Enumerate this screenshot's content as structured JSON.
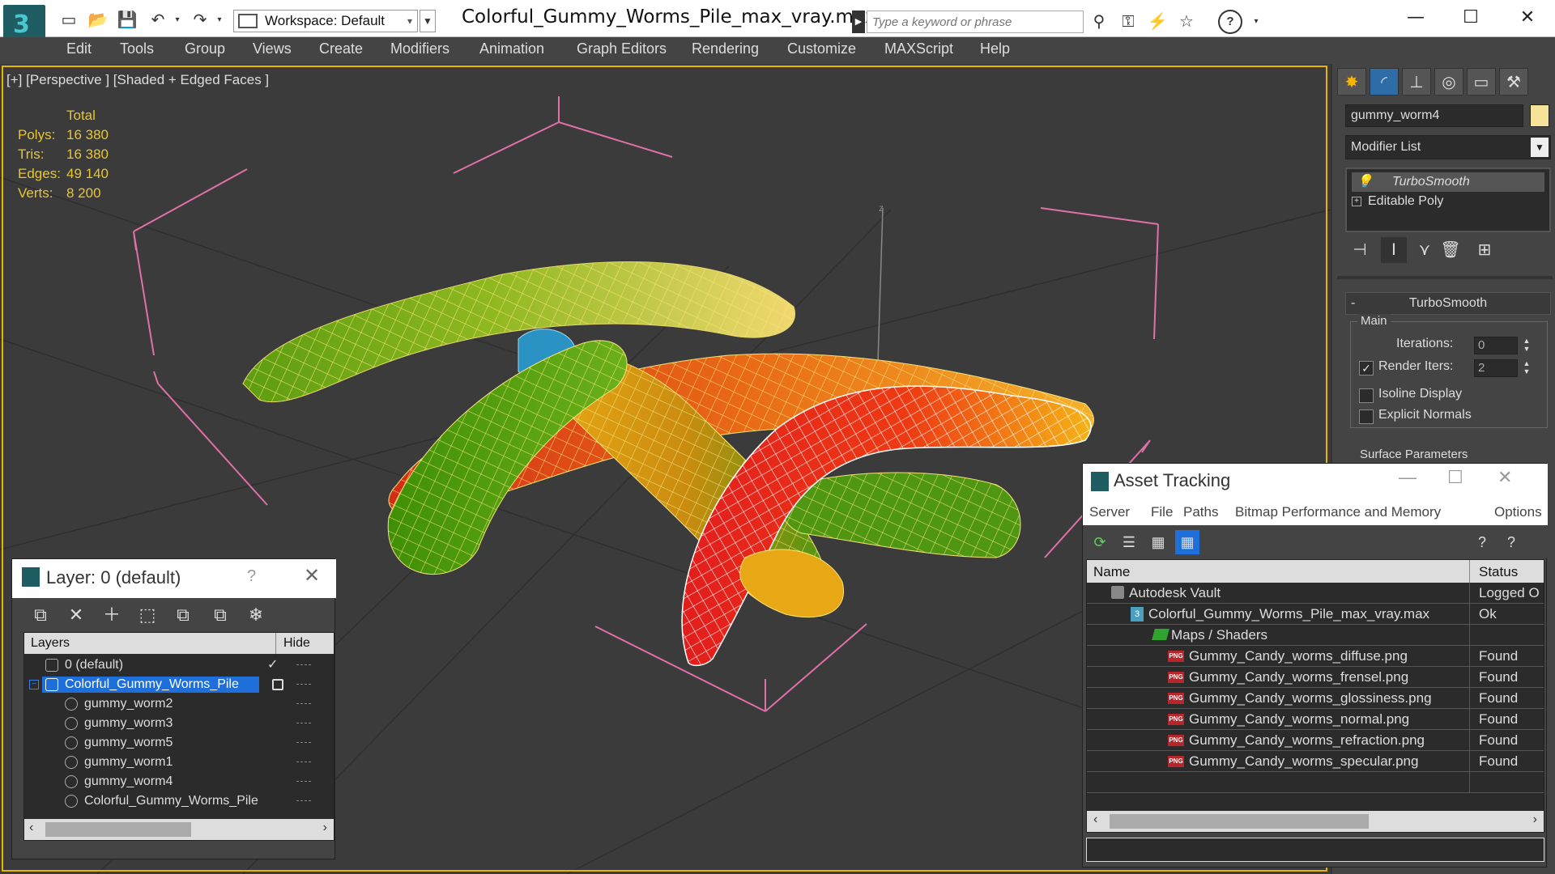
{
  "titlebar": {
    "workspace_label": "Workspace: Default",
    "document_title": "Colorful_Gummy_Worms_Pile_max_vray.max",
    "search_placeholder": "Type a keyword or phrase"
  },
  "menu": [
    "Edit",
    "Tools",
    "Group",
    "Views",
    "Create",
    "Modifiers",
    "Animation",
    "Graph Editors",
    "Rendering",
    "Customize",
    "MAXScript",
    "Help"
  ],
  "viewport": {
    "label": "[+] [Perspective ] [Shaded + Edged Faces ]",
    "stats": {
      "header": "Total",
      "rows": [
        {
          "label": "Polys:",
          "value": "16 380"
        },
        {
          "label": "Tris:",
          "value": "16 380"
        },
        {
          "label": "Edges:",
          "value": "49 140"
        },
        {
          "label": "Verts:",
          "value": "8 200"
        }
      ]
    },
    "axis_label": "z"
  },
  "command_panel": {
    "object_name": "gummy_worm4",
    "modifier_list_label": "Modifier List",
    "stack": [
      "TurboSmooth",
      "Editable Poly"
    ],
    "rollout_title": "TurboSmooth",
    "main_group": "Main",
    "iterations_label": "Iterations:",
    "iterations_value": "0",
    "render_iters_label": "Render Iters:",
    "render_iters_value": "2",
    "render_iters_checked": true,
    "isoline_label": "Isoline Display",
    "explicit_normals_label": "Explicit Normals",
    "surface_params_label": "Surface Parameters"
  },
  "layer_panel": {
    "title": "Layer: 0 (default)",
    "help": "?",
    "col_layers": "Layers",
    "col_hide": "Hide",
    "rows": [
      {
        "name": "0 (default)",
        "indent": 0,
        "selected": false,
        "check": "✓"
      },
      {
        "name": "Colorful_Gummy_Worms_Pile",
        "indent": 0,
        "selected": true,
        "check": ""
      },
      {
        "name": "gummy_worm2",
        "indent": 1,
        "selected": false,
        "check": ""
      },
      {
        "name": "gummy_worm3",
        "indent": 1,
        "selected": false,
        "check": ""
      },
      {
        "name": "gummy_worm5",
        "indent": 1,
        "selected": false,
        "check": ""
      },
      {
        "name": "gummy_worm1",
        "indent": 1,
        "selected": false,
        "check": ""
      },
      {
        "name": "gummy_worm4",
        "indent": 1,
        "selected": false,
        "check": ""
      },
      {
        "name": "Colorful_Gummy_Worms_Pile",
        "indent": 1,
        "selected": false,
        "check": ""
      }
    ]
  },
  "asset_panel": {
    "title": "Asset Tracking",
    "menu": [
      "Server",
      "File",
      "Paths",
      "Bitmap Performance and Memory",
      "Options"
    ],
    "col_name": "Name",
    "col_status": "Status",
    "rows": [
      {
        "name": "Autodesk Vault",
        "status": "Logged O",
        "indent": 0,
        "icon": "vault"
      },
      {
        "name": "Colorful_Gummy_Worms_Pile_max_vray.max",
        "status": "Ok",
        "indent": 1,
        "icon": "max"
      },
      {
        "name": "Maps / Shaders",
        "status": "",
        "indent": 2,
        "icon": "maps"
      },
      {
        "name": "Gummy_Candy_worms_diffuse.png",
        "status": "Found",
        "indent": 3,
        "icon": "png"
      },
      {
        "name": "Gummy_Candy_worms_frensel.png",
        "status": "Found",
        "indent": 3,
        "icon": "png"
      },
      {
        "name": "Gummy_Candy_worms_glossiness.png",
        "status": "Found",
        "indent": 3,
        "icon": "png"
      },
      {
        "name": "Gummy_Candy_worms_normal.png",
        "status": "Found",
        "indent": 3,
        "icon": "png"
      },
      {
        "name": "Gummy_Candy_worms_refraction.png",
        "status": "Found",
        "indent": 3,
        "icon": "png"
      },
      {
        "name": "Gummy_Candy_worms_specular.png",
        "status": "Found",
        "indent": 3,
        "icon": "png"
      }
    ]
  },
  "colors": {
    "viewport_bg": "#3b3b3b",
    "active_viewport_border": "#e7b400",
    "stats_text": "#e8c534",
    "selection_blue": "#1e6fd9",
    "bbox_pink": "#e070a8"
  }
}
